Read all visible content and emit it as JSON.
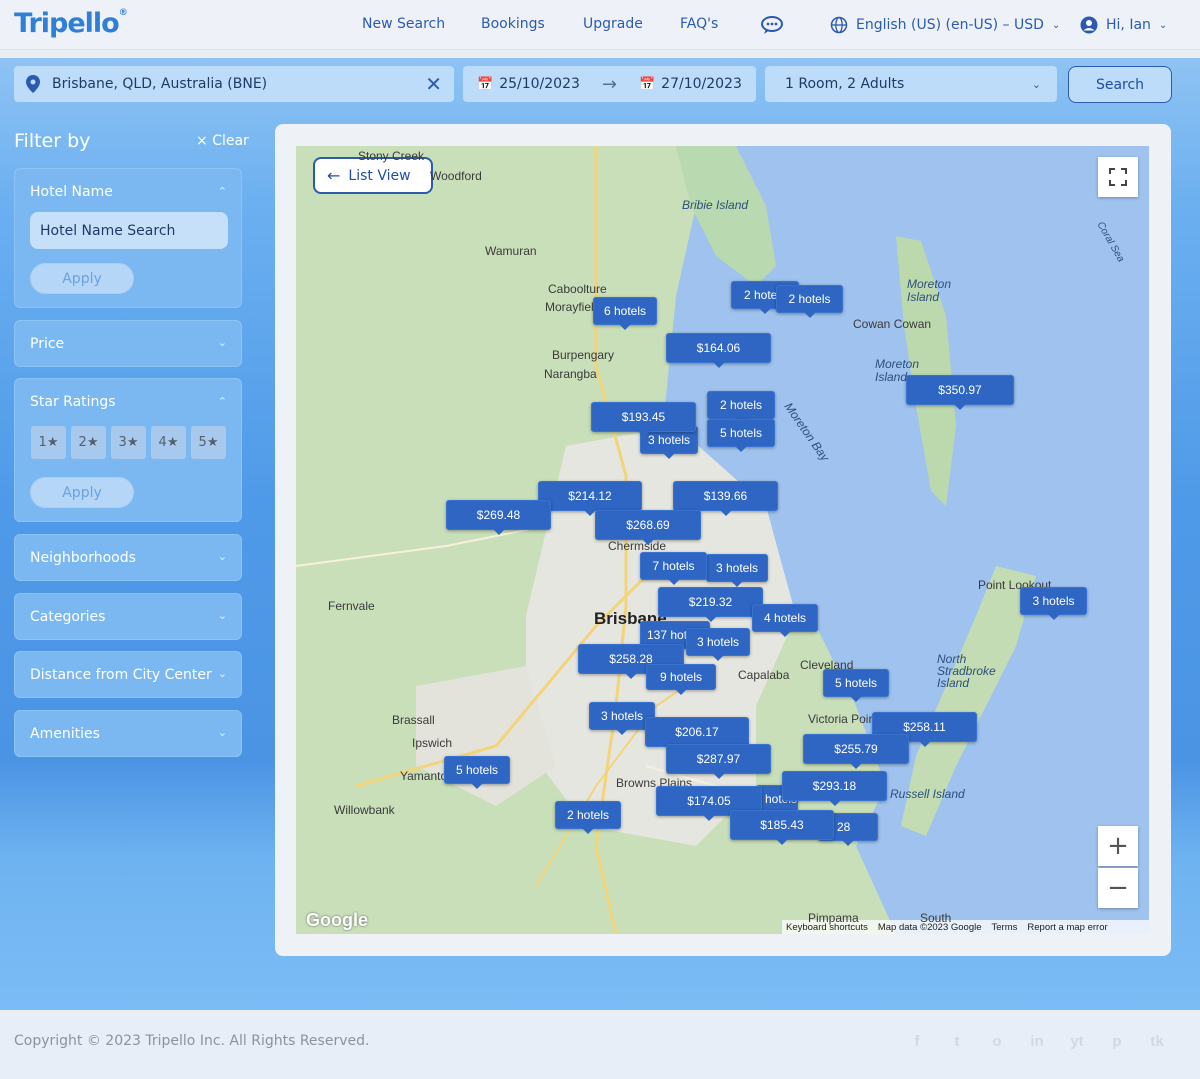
{
  "header": {
    "logo": "Tripello",
    "logo_mark": "®",
    "nav": [
      "New Search",
      "Bookings",
      "Upgrade",
      "FAQ's"
    ],
    "language": "English (US) (en-US) – USD",
    "greeting": "Hi, Ian"
  },
  "search": {
    "location": "Brisbane, QLD, Australia (BNE)",
    "check_in": "25/10/2023",
    "check_out": "27/10/2023",
    "rooms": "1 Room, 2 Adults",
    "search_label": "Search"
  },
  "sidebar": {
    "title": "Filter by",
    "clear": "Clear",
    "hotel_name": {
      "label": "Hotel Name",
      "placeholder": "Hotel Name Search",
      "apply": "Apply"
    },
    "price": "Price",
    "star_ratings": {
      "label": "Star Ratings",
      "stars": [
        "1",
        "2",
        "3",
        "4",
        "5"
      ],
      "apply": "Apply"
    },
    "neighborhoods": "Neighborhoods",
    "categories": "Categories",
    "distance": "Distance from City Center",
    "amenities": "Amenities"
  },
  "map": {
    "list_view": "List View",
    "attribution": [
      "Keyboard shortcuts",
      "Map data ©2023 Google",
      "Terms",
      "Report a map error"
    ],
    "logo": "Google",
    "zoom_in": "+",
    "zoom_out": "−",
    "places": [
      "Stony Creek",
      "Woodford",
      "Bribie Island",
      "Wamuran",
      "Caboolture",
      "Morayfield",
      "Burpengary",
      "Narangba",
      "Moreton Island",
      "Cowan Cowan",
      "Moreton Island",
      "Moreton Bay",
      "Coral Sea",
      "Brisbane",
      "Chermside",
      "Fernvale",
      "Cleveland",
      "Capalaba",
      "Victoria Point",
      "North Stradbroke Island",
      "Point Lookout",
      "Brassall",
      "Ipswich",
      "Yamanto",
      "Willowbank",
      "Browns Plains",
      "Russell Island",
      "Pimpama",
      "South"
    ],
    "markers": [
      "6 hotels",
      "2 hotels",
      "2 hotels",
      "$164.06",
      "$350.97",
      "$193.45",
      "2 hotels",
      "5 hotels",
      "3 hotels",
      "$214.12",
      "$139.66",
      "$269.48",
      "$268.69",
      "7 hotels",
      "3 hotels",
      "$219.32",
      "4 hotels",
      "3 hotels",
      "137 hotels",
      "3 hotels",
      "$258.28",
      "9 hotels",
      "5 hotels",
      "3 hotels",
      "$206.17",
      "$258.11",
      "$287.97",
      "$255.79",
      "5 hotels",
      "$293.18",
      "$174.05",
      "2 hotels",
      "$185.43",
      "hotels",
      "28"
    ]
  },
  "footer": {
    "copyright": "Copyright © 2023 Tripello Inc. All Rights Reserved.",
    "social": [
      "f",
      "t",
      "o",
      "in",
      "yt",
      "p",
      "tk"
    ]
  }
}
